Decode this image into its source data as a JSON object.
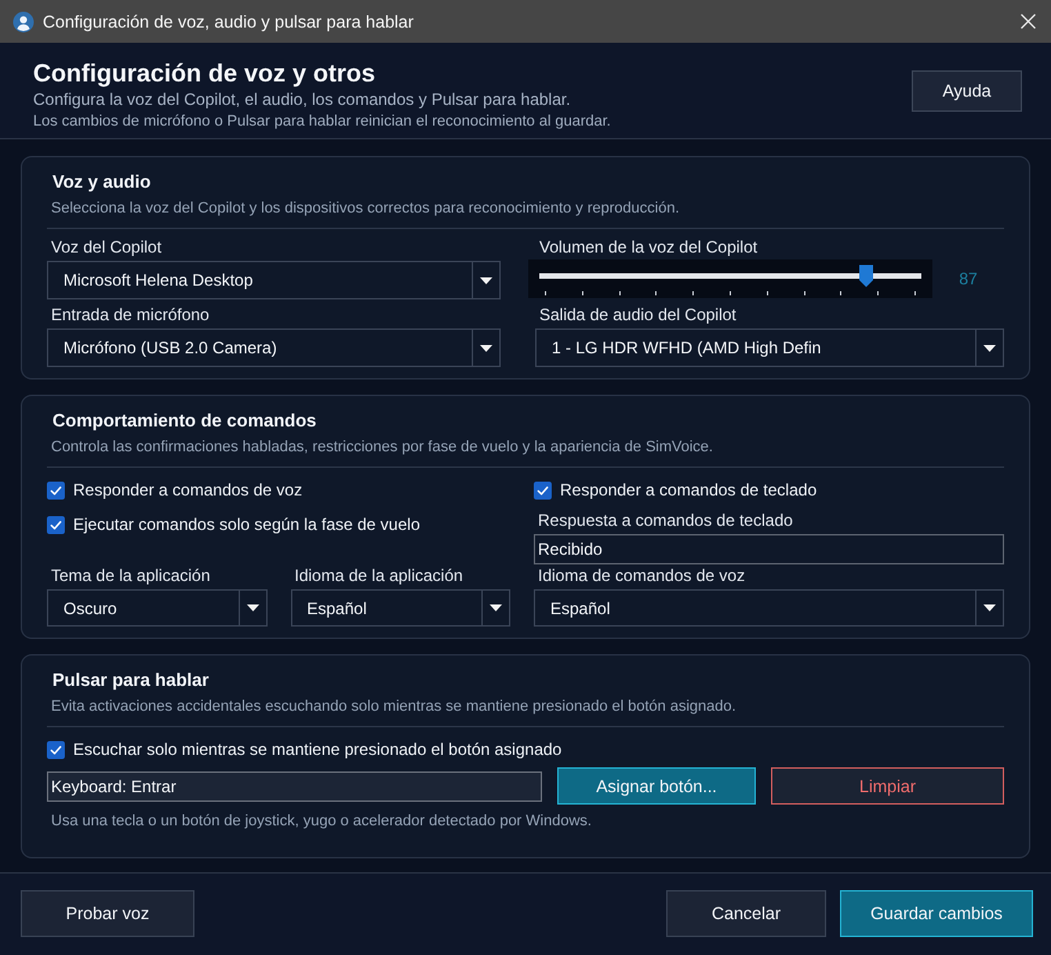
{
  "window": {
    "title": "Configuración de voz, audio y pulsar para hablar"
  },
  "header": {
    "title": "Configuración de voz y otros",
    "subtitle": "Configura la voz del Copilot, el audio, los comandos y Pulsar para hablar.",
    "note": "Los cambios de micrófono o Pulsar para hablar reinician el reconocimiento al guardar.",
    "help_button": "Ayuda"
  },
  "sections": [
    {
      "kind": "voice_audio",
      "title": "Voz y audio",
      "description": "Selecciona la voz del Copilot y los dispositivos correctos para reconocimiento y reproducción.",
      "copilot_voice": {
        "label": "Voz del Copilot",
        "value": "Microsoft Helena Desktop"
      },
      "volume": {
        "label": "Volumen de la voz del Copilot",
        "level": 0.87,
        "reading": "87"
      },
      "microphone_input": {
        "label": "Entrada de micrófono",
        "value": "Micrófono (USB 2.0 Camera)"
      },
      "audio_output": {
        "label": "Salida de audio del Copilot",
        "value": "1 - LG HDR WFHD (AMD High Defin"
      }
    },
    {
      "kind": "commands",
      "title": "Comportamiento de comandos",
      "description": "Controla las confirmaciones habladas, restricciones por fase de vuelo y la apariencia de SimVoice.",
      "checkboxes": [
        {
          "label": "Responder a comandos de voz",
          "checked": true
        },
        {
          "label": "Ejecutar comandos solo según la fase de vuelo",
          "checked": true
        }
      ],
      "keyboard_commands": {
        "label": "Responder a comandos de teclado",
        "checked": true
      },
      "keyboard_response": {
        "label": "Respuesta a comandos de teclado",
        "value": "Recibido"
      },
      "dropdowns": [
        {
          "label": "Tema de la aplicación",
          "value": "Oscuro"
        },
        {
          "label": "Idioma de la aplicación",
          "value": "Español"
        },
        {
          "label": "Idioma de comandos de voz",
          "value": "Español"
        }
      ]
    },
    {
      "kind": "push_to_talk",
      "title": "Pulsar para hablar",
      "description": "Evita activaciones accidentales escuchando solo mientras se mantiene presionado el botón asignado.",
      "checkbox": {
        "label": "Escuchar solo mientras se mantiene presionado el botón asignado",
        "checked": true
      },
      "binding": {
        "value": "Keyboard: Entrar"
      },
      "buttons": [
        {
          "label": "Asignar botón...",
          "kind": "primary"
        },
        {
          "label": "Limpiar",
          "kind": "danger"
        }
      ],
      "hint": "Usa una tecla o un botón de joystick, yugo o acelerador detectado por Windows."
    }
  ],
  "footer": {
    "buttons": [
      {
        "label": "Probar voz",
        "kind": "secondary"
      },
      {
        "label": "Cancelar",
        "kind": "secondary"
      },
      {
        "label": "Guardar cambios",
        "kind": "primary"
      }
    ]
  }
}
